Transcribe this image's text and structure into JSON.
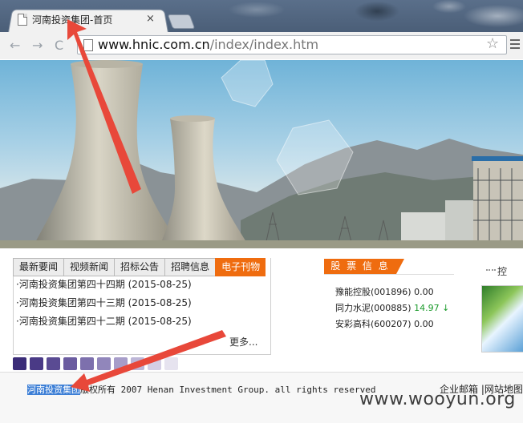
{
  "browser": {
    "tab_title": "河南投资集团-首页",
    "tab_close": "×",
    "url_host": "www.hnic.com.cn",
    "url_path": "/index/index.htm",
    "back_icon": "arrow-left-icon",
    "forward_icon": "arrow-right-icon",
    "reload_icon": "reload-icon",
    "star_glyph": "☆",
    "nav": {
      "back": "←",
      "forward": "→",
      "reload": "C"
    }
  },
  "news": {
    "tabs": [
      {
        "label": "最新要闻"
      },
      {
        "label": "视频新闻"
      },
      {
        "label": "招标公告"
      },
      {
        "label": "招聘信息"
      },
      {
        "label": "电子刊物"
      }
    ],
    "active_tab": 4,
    "items": [
      "·河南投资集团第四十四期 (2015-08-25)",
      "·河南投资集团第四十三期 (2015-08-25)",
      "·河南投资集团第四十二期 (2015-08-25)"
    ],
    "more": "更多..."
  },
  "stocks": {
    "header": "股 票 信 息",
    "items": [
      {
        "name": "豫能控股(001896)",
        "value": "0.00",
        "trend": ""
      },
      {
        "name": "同力水泥(000885)",
        "value": "14.97",
        "trend": "↓"
      },
      {
        "name": "安彩高科(600207)",
        "value": "0.00",
        "trend": ""
      }
    ]
  },
  "right_panel": {
    "title": "控"
  },
  "footer": {
    "highlight": "河南投资集团",
    "copyright": "版权所有 2007 Henan Investment Group. all rights reserved",
    "links": "企业邮箱 |网站地图"
  },
  "watermark": "www.wooyun.org",
  "colors": {
    "accent": "#ef6c0f",
    "highlight": "#3d7fd6",
    "arrow": "#e8483a"
  },
  "squares": [
    "#3b2c78",
    "#4a3a86",
    "#5a4b93",
    "#6b5ca0",
    "#7d70ad",
    "#9186bb",
    "#a79dc9",
    "#bdb6d7",
    "#d4cfe5",
    "#e6e3ef"
  ]
}
